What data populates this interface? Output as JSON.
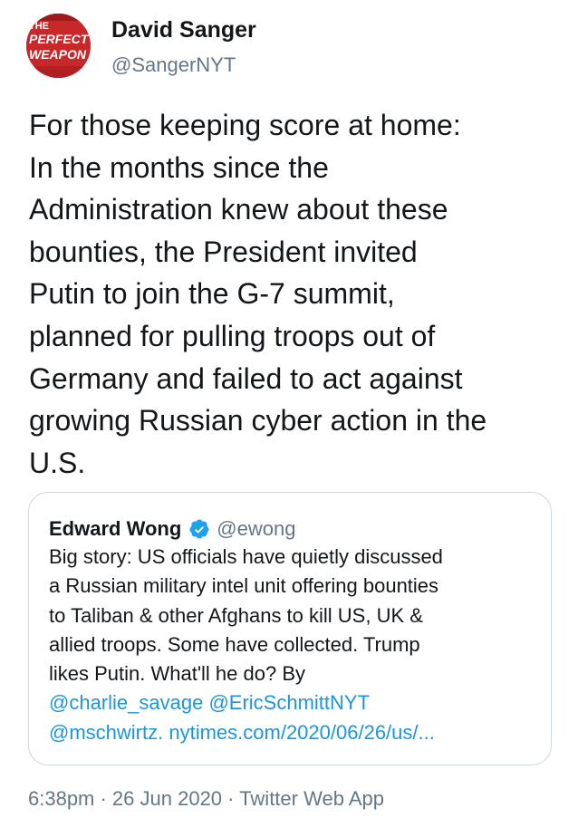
{
  "author": {
    "name": "David Sanger",
    "handle": "@SangerNYT",
    "avatar_logo_lines": [
      "THE",
      "PERFECT",
      "WEAPON"
    ]
  },
  "tweet": {
    "text_lines": [
      "For those keeping score at home:",
      "In the months since the",
      "Administration knew about these",
      "bounties, the President invited",
      "Putin to join the G-7 summit,",
      "planned for pulling troops out of",
      "Germany and failed to act against",
      "growing Russian cyber action in the",
      "U.S."
    ]
  },
  "quoted_tweet": {
    "name": "Edward Wong",
    "verified": true,
    "handle": "@ewong",
    "text_lines": [
      "Big story: US officials have quietly discussed",
      "a Russian military intel unit offering bounties",
      "to Taliban & other Afghans to kill US, UK &",
      "allied troops. Some have collected. Trump",
      "likes Putin. What'll he do? By"
    ],
    "mentions_line1": [
      "@charlie_savage",
      "@EricSchmittNYT"
    ],
    "mention_line2": "@mschwirtz.",
    "link": "nytimes.com/2020/06/26/us/..."
  },
  "meta": {
    "timestamp": "6:38pm · 26 Jun 2020 · Twitter Web App"
  },
  "colors": {
    "link": "#1b95e0",
    "secondary_text": "#657786",
    "verified_badge": "#1da1f2",
    "avatar_bg": "#c8282a"
  }
}
